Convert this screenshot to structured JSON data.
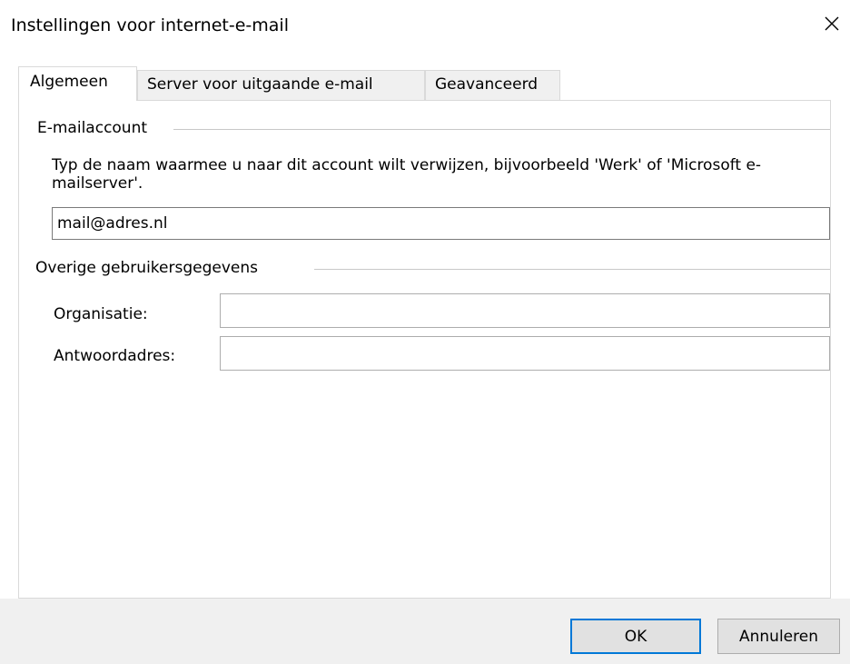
{
  "window": {
    "title": "Instellingen voor internet-e-mail"
  },
  "tabs": [
    {
      "label": "Algemeen",
      "active": true
    },
    {
      "label": "Server voor uitgaande e-mail",
      "active": false
    },
    {
      "label": "Geavanceerd",
      "active": false
    }
  ],
  "email_account": {
    "group_label": "E-mailaccount",
    "description": "Typ de naam waarmee u naar dit account wilt verwijzen, bijvoorbeeld 'Werk' of 'Microsoft e-mailserver'.",
    "account_name_value": "mail@adres.nl"
  },
  "user_info": {
    "group_label": "Overige gebruikersgegevens",
    "organization_label": "Organisatie:",
    "organization_value": "",
    "reply_address_label": "Antwoordadres:",
    "reply_address_value": ""
  },
  "buttons": {
    "ok_label": "OK",
    "cancel_label": "Annuleren"
  },
  "colors": {
    "accent": "#0078d7",
    "footer_bg": "#f0f0f0",
    "tab_bg": "#f0f0f0"
  }
}
